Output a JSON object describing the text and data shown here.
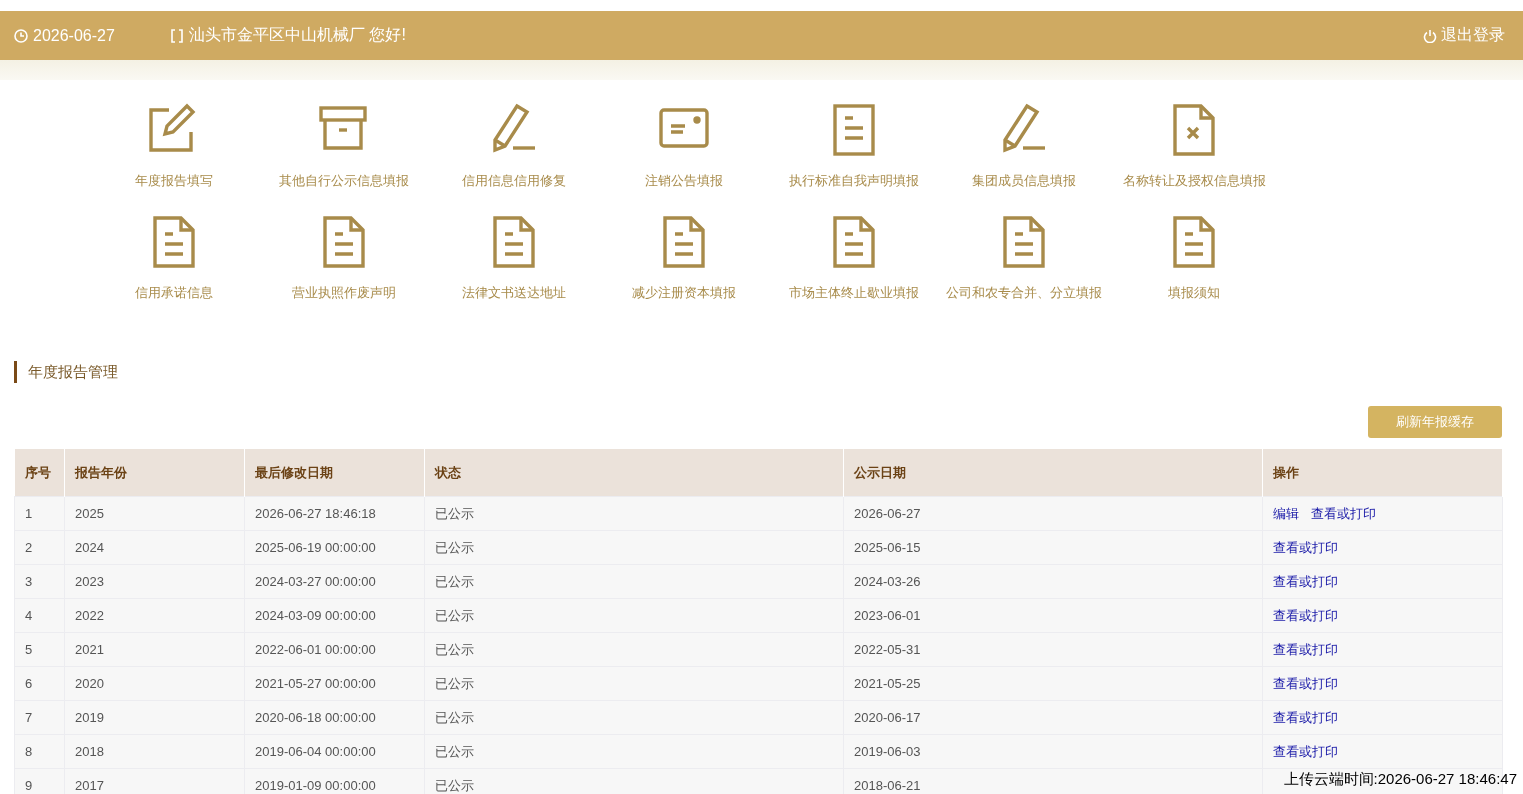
{
  "header": {
    "date": "2026-06-27",
    "greeting": "汕头市金平区中山机械厂 您好!",
    "logout": "退出登录"
  },
  "shortcuts": [
    {
      "label": "年度报告填写",
      "kind": "edit"
    },
    {
      "label": "其他自行公示信息填报",
      "kind": "archive"
    },
    {
      "label": "信用信息信用修复",
      "kind": "pencil"
    },
    {
      "label": "注销公告填报",
      "kind": "card"
    },
    {
      "label": "执行标准自我声明填报",
      "kind": "lines"
    },
    {
      "label": "集团成员信息填报",
      "kind": "pencil"
    },
    {
      "label": "名称转让及授权信息填报",
      "kind": "docx"
    },
    {
      "label": "信用承诺信息",
      "kind": "doc"
    },
    {
      "label": "营业执照作废声明",
      "kind": "doc"
    },
    {
      "label": "法律文书送达地址",
      "kind": "doc"
    },
    {
      "label": "减少注册资本填报",
      "kind": "doc"
    },
    {
      "label": "市场主体终止歇业填报",
      "kind": "doc"
    },
    {
      "label": "公司和农专合并、分立填报",
      "kind": "doc"
    },
    {
      "label": "填报须知",
      "kind": "doc"
    }
  ],
  "section": {
    "title": "年度报告管理",
    "refresh_button": "刷新年报缓存"
  },
  "table": {
    "columns": [
      "序号",
      "报告年份",
      "最后修改日期",
      "状态",
      "公示日期",
      "操作"
    ],
    "rows": [
      {
        "cells": [
          "1",
          "2025",
          "2026-06-27 18:46:18",
          "已公示",
          "2026-06-27"
        ],
        "actions": [
          "编辑",
          "查看或打印"
        ]
      },
      {
        "cells": [
          "2",
          "2024",
          "2025-06-19 00:00:00",
          "已公示",
          "2025-06-15"
        ],
        "actions": [
          "查看或打印"
        ]
      },
      {
        "cells": [
          "3",
          "2023",
          "2024-03-27 00:00:00",
          "已公示",
          "2024-03-26"
        ],
        "actions": [
          "查看或打印"
        ]
      },
      {
        "cells": [
          "4",
          "2022",
          "2024-03-09 00:00:00",
          "已公示",
          "2023-06-01"
        ],
        "actions": [
          "查看或打印"
        ]
      },
      {
        "cells": [
          "5",
          "2021",
          "2022-06-01 00:00:00",
          "已公示",
          "2022-05-31"
        ],
        "actions": [
          "查看或打印"
        ]
      },
      {
        "cells": [
          "6",
          "2020",
          "2021-05-27 00:00:00",
          "已公示",
          "2021-05-25"
        ],
        "actions": [
          "查看或打印"
        ]
      },
      {
        "cells": [
          "7",
          "2019",
          "2020-06-18 00:00:00",
          "已公示",
          "2020-06-17"
        ],
        "actions": [
          "查看或打印"
        ]
      },
      {
        "cells": [
          "8",
          "2018",
          "2019-06-04 00:00:00",
          "已公示",
          "2019-06-03"
        ],
        "actions": [
          "查看或打印"
        ]
      },
      {
        "cells": [
          "9",
          "2017",
          "2019-01-09 00:00:00",
          "已公示",
          "2018-06-21"
        ],
        "actions": []
      }
    ]
  },
  "upload_stamp": "上传云端时间:2026-06-27 18:46:47"
}
